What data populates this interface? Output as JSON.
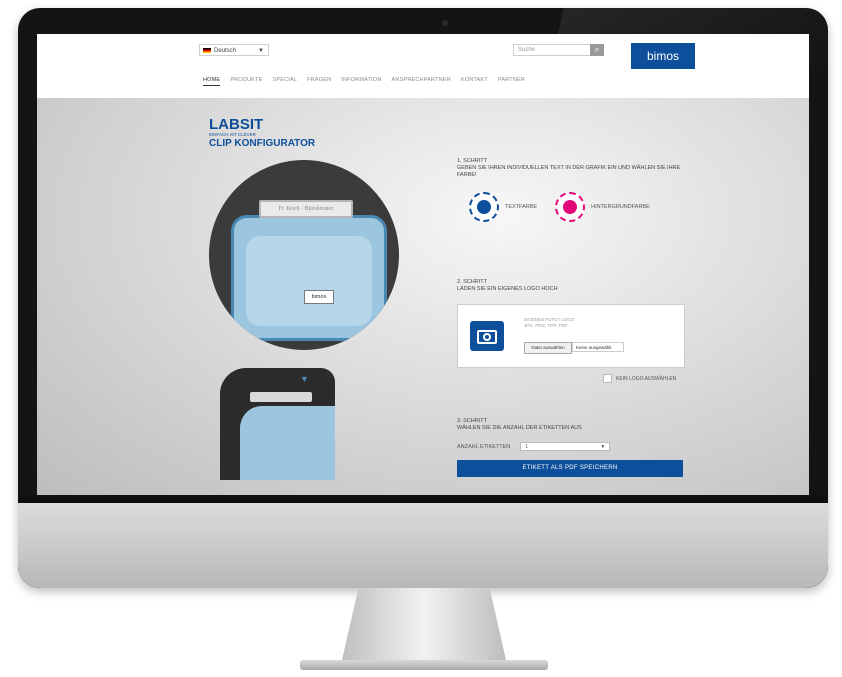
{
  "header": {
    "language": "Deutsch",
    "search_placeholder": "Suche",
    "brand": "bimos",
    "nav": [
      "HOME",
      "PRODUKTE",
      "SPECIAL",
      "FRAGEN",
      "INFORMATION",
      "ANSPRECHPARTNER",
      "KONTAKT",
      "PARTNER"
    ]
  },
  "page": {
    "title": "LABSIT",
    "subtitle": "EINFACH IST CLEVER",
    "title2": "CLIP KONFIGURATOR"
  },
  "illustration": {
    "label_text": "Fr. Koch · Büroberater",
    "clip_logo": "bimos"
  },
  "step1": {
    "heading": "1. SCHRITT",
    "text": "GEBEN SIE IHREN INDIVIDUELLEN TEXT IN DER GRAFIK EIN UND WÄHLEN SIE IHRE FARBE!",
    "text_color_label": "TEXTFARBE",
    "bg_color_label": "HINTERGRUNDFARBE",
    "text_color": "#0d4f9a",
    "bg_color": "#e20a7a"
  },
  "step2": {
    "heading": "2. SCHRITT",
    "text": "LADEN SIE EIN EIGENES LOGO HOCH",
    "upload_title": "EIGENES FOTO / LOGO",
    "upload_formats": "JPG, PNG, TIFF, PDF",
    "file_button": "Datei auswählen",
    "file_status": "Keine ausgewählt",
    "no_logo_label": "KEIN LOGO AUSWÄHLEN"
  },
  "step3": {
    "heading": "3. SCHRITT",
    "text": "WÄHLEN SIE DIE ANZAHL DER ETIKETTEN AUS",
    "count_label": "ANZAHL ETIKETTEN",
    "count_value": "1"
  },
  "cta": {
    "save_pdf": "ETIKETT ALS PDF SPEICHERN"
  }
}
